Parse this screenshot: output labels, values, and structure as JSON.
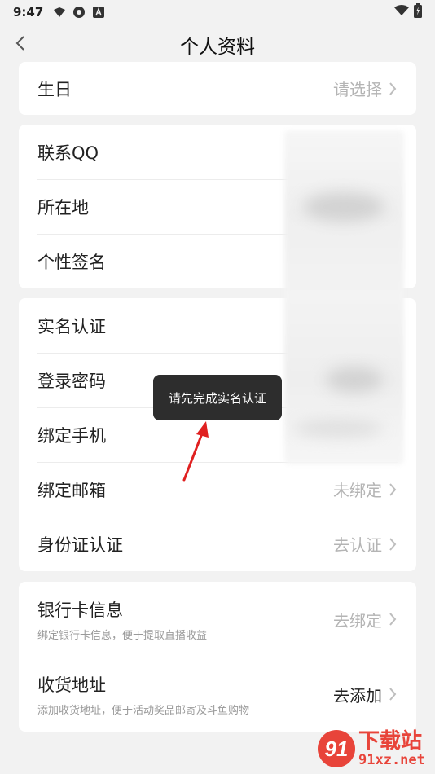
{
  "status_bar": {
    "time": "9:47"
  },
  "header": {
    "title": "个人资料"
  },
  "card1": {
    "birthday": {
      "label": "生日",
      "value": "请选择"
    }
  },
  "card2": {
    "qq": {
      "label": "联系QQ"
    },
    "location": {
      "label": "所在地"
    },
    "signature": {
      "label": "个性签名"
    }
  },
  "card3": {
    "realname": {
      "label": "实名认证"
    },
    "password": {
      "label": "登录密码"
    },
    "phone": {
      "label": "绑定手机"
    },
    "email": {
      "label": "绑定邮箱",
      "value": "未绑定"
    },
    "idcard": {
      "label": "身份证认证",
      "value": "去认证"
    }
  },
  "card4": {
    "bank": {
      "label": "银行卡信息",
      "desc": "绑定银行卡信息，便于提取直播收益",
      "value": "去绑定"
    },
    "address": {
      "label": "收货地址",
      "desc": "添加收货地址，便于活动奖品邮寄及斗鱼购物",
      "value": "去添加"
    }
  },
  "toast": {
    "text": "请先完成实名认证"
  },
  "watermark": {
    "brand_cn": "下载站",
    "brand_en": "91xz.net",
    "logo_mark": "91"
  },
  "colors": {
    "background": "#f2f2f2",
    "toast_bg": "#2d2d2d",
    "arrow": "#e02020",
    "watermark": "#e8443a"
  }
}
